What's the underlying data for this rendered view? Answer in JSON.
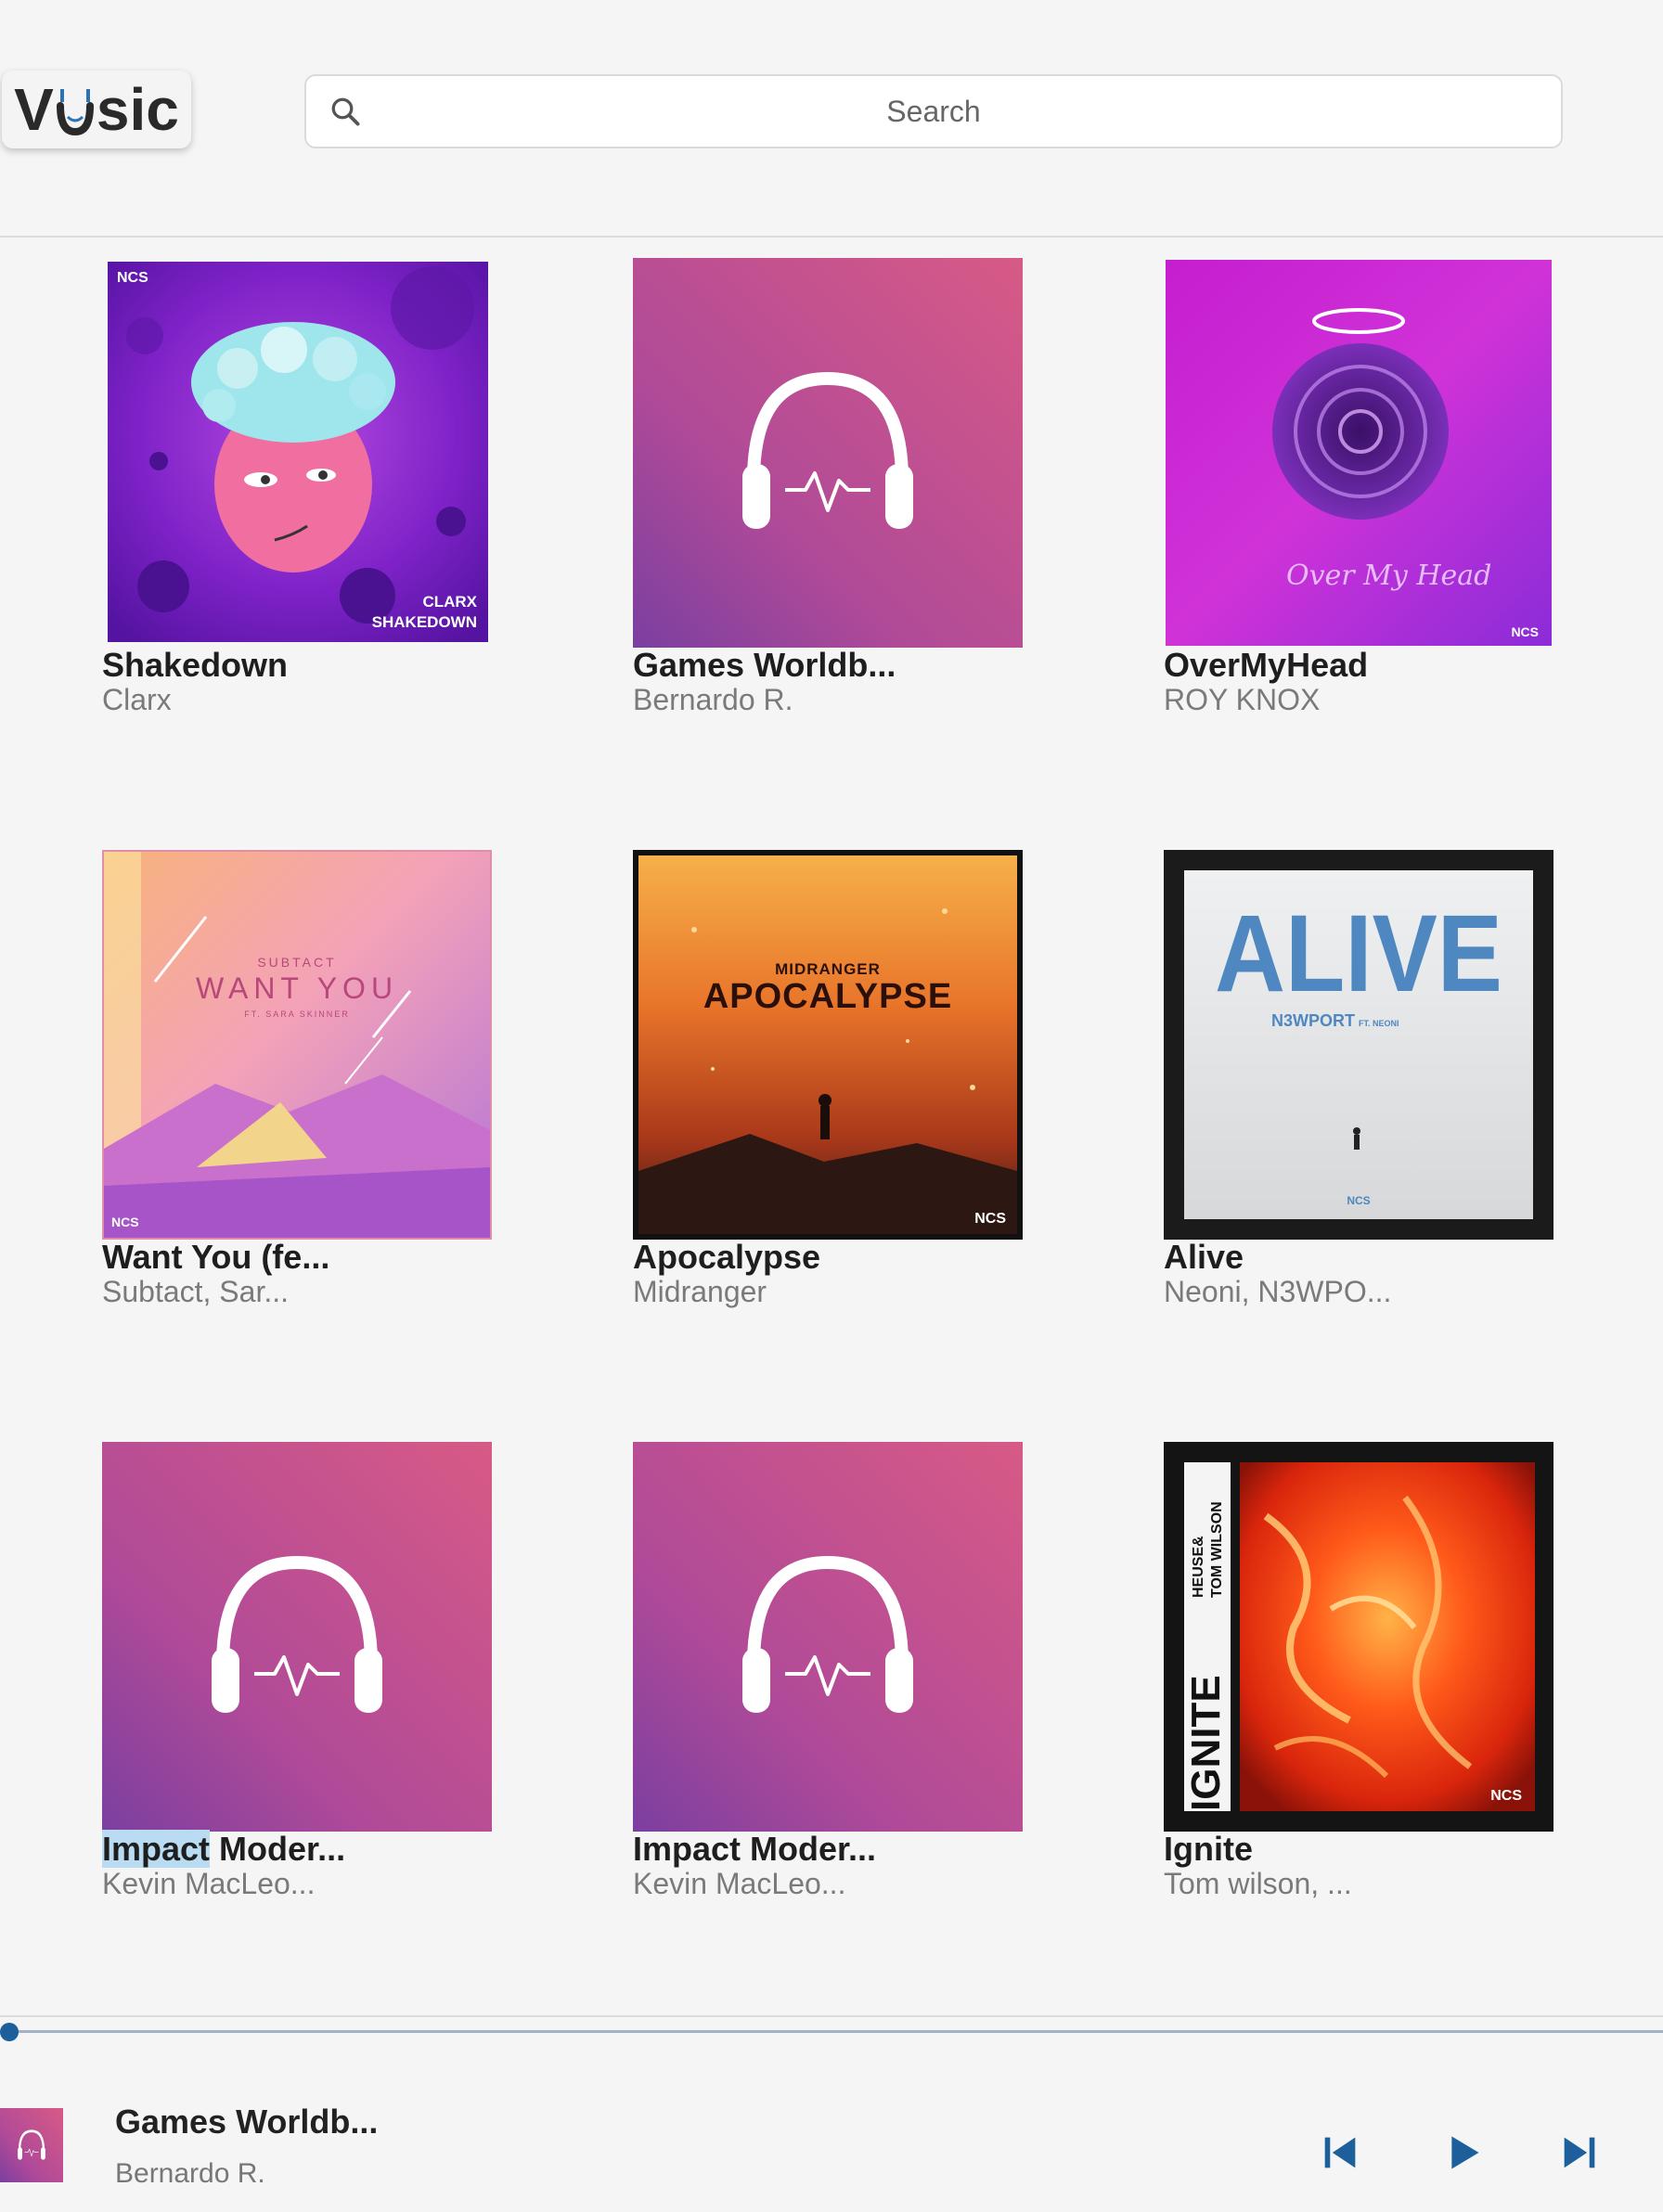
{
  "app": {
    "logo_left": "V",
    "logo_right": "sic",
    "logo_accent": "#2a73b8"
  },
  "search": {
    "placeholder": "Search",
    "value": ""
  },
  "tracks": [
    {
      "title": "Shakedown",
      "artist": "Clarx",
      "cover": "shakedown"
    },
    {
      "title": "Games Worldb...",
      "artist": "Bernardo R.",
      "cover": "placeholder"
    },
    {
      "title": "OverMyHead",
      "artist": "ROY KNOX",
      "cover": "overmyhead"
    },
    {
      "title": "Want You (fe...",
      "artist": "Subtact, Sar...",
      "cover": "wantyou"
    },
    {
      "title": "Apocalypse",
      "artist": "Midranger",
      "cover": "apocalypse"
    },
    {
      "title": "Alive",
      "artist": "Neoni, N3WPO...",
      "cover": "alive"
    },
    {
      "title_selected": "Impact",
      "title_rest": " Moder...",
      "title": "Impact Moder...",
      "artist": "Kevin MacLeo...",
      "cover": "placeholder"
    },
    {
      "title": "Impact Moder...",
      "artist": "Kevin MacLeo...",
      "cover": "placeholder"
    },
    {
      "title": "Ignite",
      "artist": "Tom wilson, ...",
      "cover": "ignite"
    }
  ],
  "cover_text": {
    "ncs": "NCS",
    "shakedown_line1": "CLARX",
    "shakedown_line2": "SHAKEDOWN",
    "overmyhead_script": "Over My Head",
    "wantyou_artist": "SUBTACT",
    "wantyou_title": "WANT YOU",
    "wantyou_feat": "FT. SARA SKINNER",
    "apocalypse_artist": "MIDRANGER",
    "apocalypse_title": "APOCALYPSE",
    "alive_title": "ALIVE",
    "alive_artist": "N3WPORT",
    "alive_feat": "FT. NEONI",
    "ignite_title": "IGNITE",
    "ignite_artists_1": "HEUSE&",
    "ignite_artists_2": "TOM WILSON"
  },
  "now_playing": {
    "title": "Games Worldb...",
    "artist": "Bernardo R.",
    "progress": 0
  },
  "controls": {
    "prev_icon": "skip-previous-icon",
    "play_icon": "play-icon",
    "next_icon": "skip-next-icon",
    "color": "#1d5f9a"
  }
}
